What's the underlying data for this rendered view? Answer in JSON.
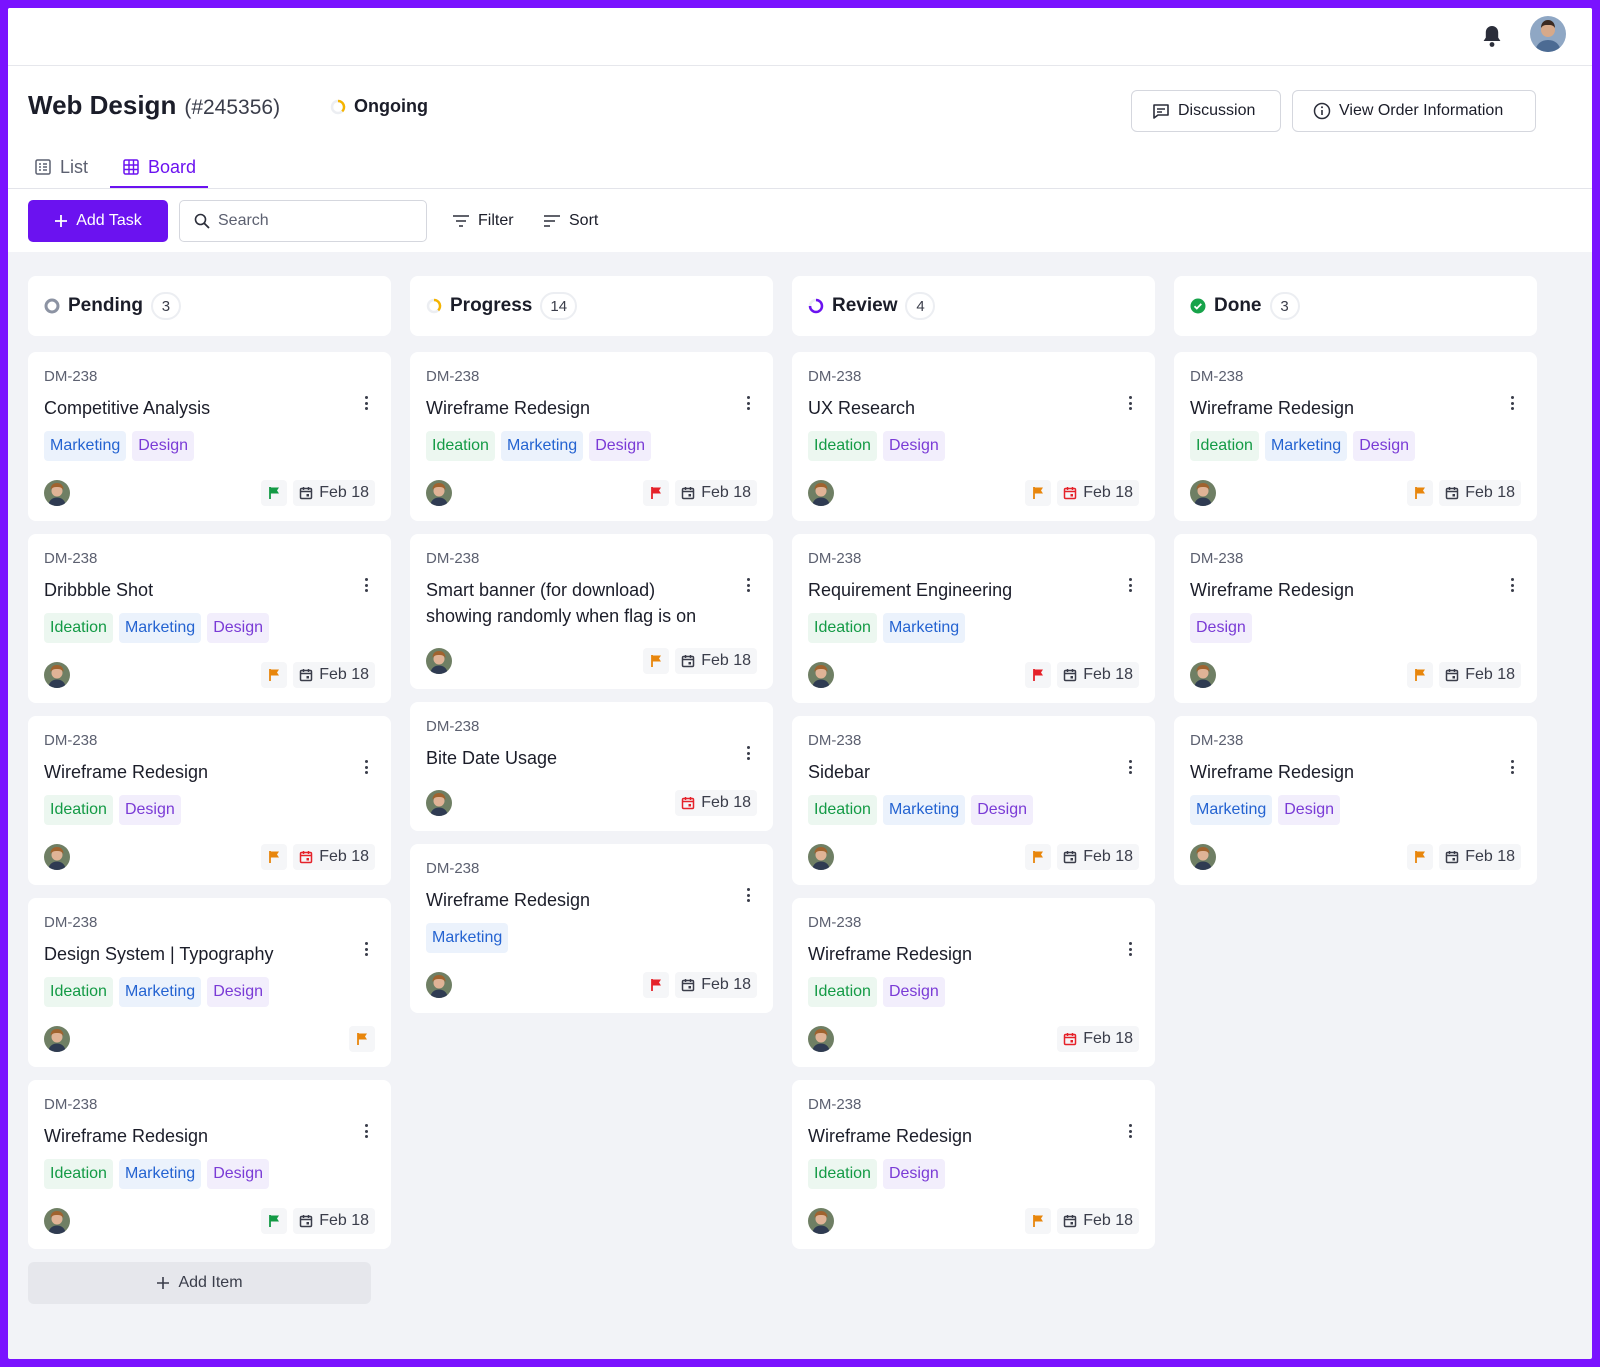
{
  "project": {
    "title": "Web Design",
    "id_label": "(#245356)",
    "status": "Ongoing"
  },
  "header_buttons": {
    "discussion": "Discussion",
    "order_info": "View Order Information"
  },
  "tabs": [
    {
      "label": "List",
      "icon": "list-icon",
      "active": false
    },
    {
      "label": "Board",
      "icon": "board-grid-icon",
      "active": true
    }
  ],
  "toolbar": {
    "add_task": "Add Task",
    "search_placeholder": "Search",
    "filter": "Filter",
    "sort": "Sort"
  },
  "colors": {
    "accent": "#6b12f0",
    "frame": "#7a12ff",
    "flag_green": "#139a45",
    "flag_red": "#e5222a",
    "flag_orange": "#e8860c",
    "date_red": "#e5222a"
  },
  "columns": [
    {
      "name": "Pending",
      "count": "3",
      "status_icon": "pending-circle-icon",
      "cards": [
        {
          "id": "DM-238",
          "title": "Competitive Analysis",
          "tags": [
            "Marketing",
            "Design"
          ],
          "flag": "green",
          "date": "Feb 18",
          "date_overdue": false
        },
        {
          "id": "DM-238",
          "title": "Dribbble Shot",
          "tags": [
            "Ideation",
            "Marketing",
            "Design"
          ],
          "flag": "orange",
          "date": "Feb 18",
          "date_overdue": false
        },
        {
          "id": "DM-238",
          "title": "Wireframe Redesign",
          "tags": [
            "Ideation",
            "Design"
          ],
          "flag": "orange",
          "date": "Feb 18",
          "date_overdue": true
        },
        {
          "id": "DM-238",
          "title": "Design System | Typography",
          "tags": [
            "Ideation",
            "Marketing",
            "Design"
          ],
          "flag": "orange",
          "date": null,
          "date_overdue": false
        },
        {
          "id": "DM-238",
          "title": "Wireframe Redesign",
          "tags": [
            "Ideation",
            "Marketing",
            "Design"
          ],
          "flag": "green",
          "date": "Feb 18",
          "date_overdue": false
        }
      ],
      "add_item": "Add Item"
    },
    {
      "name": "Progress",
      "count": "14",
      "status_icon": "progress-arc-icon",
      "cards": [
        {
          "id": "DM-238",
          "title": "Wireframe Redesign",
          "tags": [
            "Ideation",
            "Marketing",
            "Design"
          ],
          "flag": "red",
          "date": "Feb 18",
          "date_overdue": false
        },
        {
          "id": "DM-238",
          "title": "Smart banner (for download) showing randomly when flag is on",
          "tags": [],
          "flag": "orange",
          "date": "Feb 18",
          "date_overdue": false
        },
        {
          "id": "DM-238",
          "title": "Bite Date Usage",
          "tags": [],
          "flag": null,
          "date": "Feb 18",
          "date_overdue": true
        },
        {
          "id": "DM-238",
          "title": "Wireframe Redesign",
          "tags": [
            "Marketing"
          ],
          "flag": "red",
          "date": "Feb 18",
          "date_overdue": false
        }
      ]
    },
    {
      "name": "Review",
      "count": "4",
      "status_icon": "review-arc-icon",
      "cards": [
        {
          "id": "DM-238",
          "title": "UX Research",
          "tags": [
            "Ideation",
            "Design"
          ],
          "flag": "orange",
          "date": "Feb 18",
          "date_overdue": true
        },
        {
          "id": "DM-238",
          "title": "Requirement Engineering",
          "tags": [
            "Ideation",
            "Marketing"
          ],
          "flag": "red",
          "date": "Feb 18",
          "date_overdue": false
        },
        {
          "id": "DM-238",
          "title": "Sidebar",
          "tags": [
            "Ideation",
            "Marketing",
            "Design"
          ],
          "flag": "orange",
          "date": "Feb 18",
          "date_overdue": false
        },
        {
          "id": "DM-238",
          "title": "Wireframe Redesign",
          "tags": [
            "Ideation",
            "Design"
          ],
          "flag": null,
          "date": "Feb 18",
          "date_overdue": true
        },
        {
          "id": "DM-238",
          "title": "Wireframe Redesign",
          "tags": [
            "Ideation",
            "Design"
          ],
          "flag": "orange",
          "date": "Feb 18",
          "date_overdue": false
        }
      ]
    },
    {
      "name": "Done",
      "count": "3",
      "status_icon": "done-check-icon",
      "cards": [
        {
          "id": "DM-238",
          "title": "Wireframe Redesign",
          "tags": [
            "Ideation",
            "Marketing",
            "Design"
          ],
          "flag": "orange",
          "date": "Feb 18",
          "date_overdue": false
        },
        {
          "id": "DM-238",
          "title": "Wireframe Redesign",
          "tags": [
            "Design"
          ],
          "flag": "orange",
          "date": "Feb 18",
          "date_overdue": false
        },
        {
          "id": "DM-238",
          "title": "Wireframe Redesign",
          "tags": [
            "Marketing",
            "Design"
          ],
          "flag": "orange",
          "date": "Feb 18",
          "date_overdue": false
        }
      ]
    }
  ]
}
